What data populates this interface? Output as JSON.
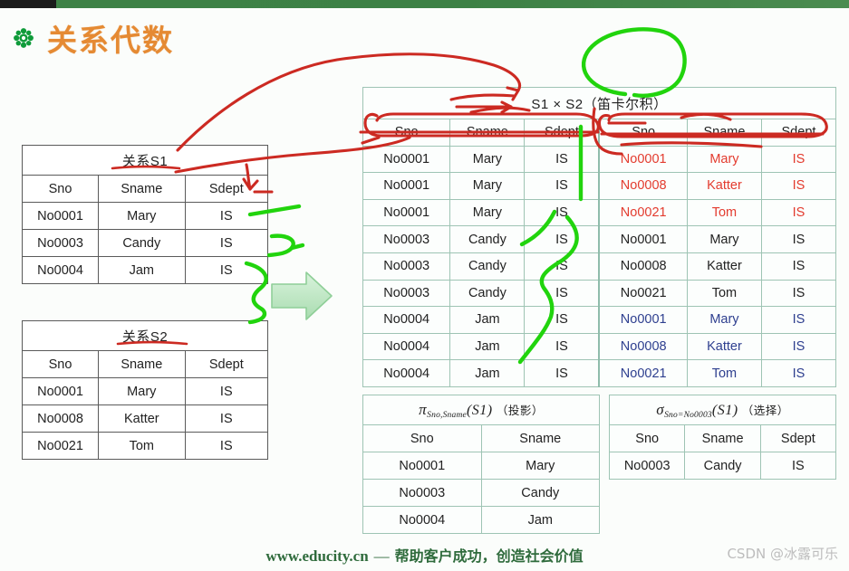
{
  "slide": {
    "title": "关系代数",
    "title_color": "#e58a33",
    "bullet_icon": "flower-bullet-icon",
    "topbar_color": "#3d8145",
    "background": "#fbfdfb"
  },
  "tables": {
    "s1": {
      "caption": "关系S1",
      "columns": [
        "Sno",
        "Sname",
        "Sdept"
      ],
      "rows": [
        [
          "No0001",
          "Mary",
          "IS"
        ],
        [
          "No0003",
          "Candy",
          "IS"
        ],
        [
          "No0004",
          "Jam",
          "IS"
        ]
      ]
    },
    "s2": {
      "caption": "关系S2",
      "columns": [
        "Sno",
        "Sname",
        "Sdept"
      ],
      "rows": [
        [
          "No0001",
          "Mary",
          "IS"
        ],
        [
          "No0008",
          "Katter",
          "IS"
        ],
        [
          "No0021",
          "Tom",
          "IS"
        ]
      ]
    },
    "product": {
      "caption": "S1 × S2（笛卡尔积）",
      "columns": [
        "Sno",
        "Sname",
        "Sdept",
        "Sno",
        "Sname",
        "Sdept"
      ],
      "rows": [
        {
          "left": [
            "No0001",
            "Mary",
            "IS"
          ],
          "right": [
            "No0001",
            "Mary",
            "IS"
          ],
          "right_color": "red"
        },
        {
          "left": [
            "No0001",
            "Mary",
            "IS"
          ],
          "right": [
            "No0008",
            "Katter",
            "IS"
          ],
          "right_color": "red"
        },
        {
          "left": [
            "No0001",
            "Mary",
            "IS"
          ],
          "right": [
            "No0021",
            "Tom",
            "IS"
          ],
          "right_color": "red"
        },
        {
          "left": [
            "No0003",
            "Candy",
            "IS"
          ],
          "right": [
            "No0001",
            "Mary",
            "IS"
          ],
          "right_color": "black"
        },
        {
          "left": [
            "No0003",
            "Candy",
            "IS"
          ],
          "right": [
            "No0008",
            "Katter",
            "IS"
          ],
          "right_color": "black"
        },
        {
          "left": [
            "No0003",
            "Candy",
            "IS"
          ],
          "right": [
            "No0021",
            "Tom",
            "IS"
          ],
          "right_color": "black"
        },
        {
          "left": [
            "No0004",
            "Jam",
            "IS"
          ],
          "right": [
            "No0001",
            "Mary",
            "IS"
          ],
          "right_color": "blue"
        },
        {
          "left": [
            "No0004",
            "Jam",
            "IS"
          ],
          "right": [
            "No0008",
            "Katter",
            "IS"
          ],
          "right_color": "blue"
        },
        {
          "left": [
            "No0004",
            "Jam",
            "IS"
          ],
          "right": [
            "No0021",
            "Tom",
            "IS"
          ],
          "right_color": "blue"
        }
      ],
      "red_color": "#e33b2e",
      "blue_color": "#2e3f8f"
    },
    "projection": {
      "operator": "π",
      "subscript": "Sno,Sname",
      "argument": "(S1)",
      "note": "（投影）",
      "columns": [
        "Sno",
        "Sname"
      ],
      "rows": [
        [
          "No0001",
          "Mary"
        ],
        [
          "No0003",
          "Candy"
        ],
        [
          "No0004",
          "Jam"
        ]
      ]
    },
    "selection": {
      "operator": "σ",
      "subscript": "Sno=No0003",
      "argument": "(S1)",
      "note": "（选择）",
      "columns": [
        "Sno",
        "Sname",
        "Sdept"
      ],
      "rows": [
        [
          "No0003",
          "Candy",
          "IS"
        ]
      ]
    }
  },
  "annotations": {
    "ink_red": "#cc2a22",
    "ink_green": "#21d40d",
    "arrow_fill": "#bfe8c4"
  },
  "footer": {
    "site": "www.educity.cn",
    "dash": "—",
    "slogan": "帮助客户成功，创造社会价值"
  },
  "watermark": "CSDN @冰露可乐"
}
